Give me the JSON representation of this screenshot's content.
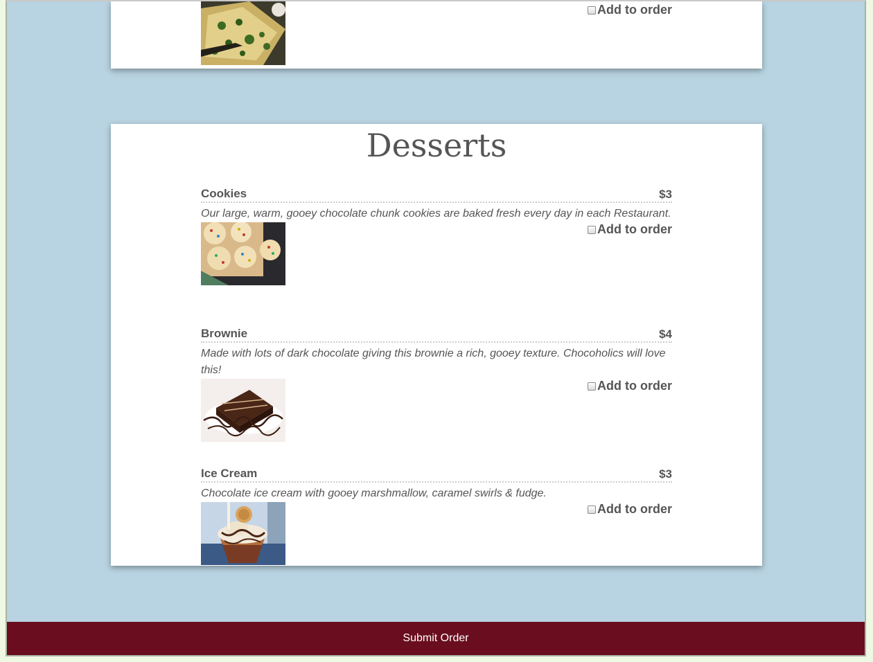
{
  "top_partial": {
    "add_label": "Add to order"
  },
  "desserts": {
    "title": "Desserts",
    "items": [
      {
        "name": "Cookies",
        "price": "$3",
        "description": "Our large, warm, gooey chocolate chunk cookies are baked fresh every day in each Restaurant.",
        "add_label": "Add to order",
        "image_icon": "cookies-photo"
      },
      {
        "name": "Brownie",
        "price": "$4",
        "description": "Made with lots of dark chocolate giving this brownie a rich, gooey texture. Chocoholics will love this!",
        "add_label": "Add to order",
        "image_icon": "brownie-photo"
      },
      {
        "name": "Ice Cream",
        "price": "$3",
        "description": "Chocolate ice cream with gooey marshmallow, caramel swirls & fudge.",
        "add_label": "Add to order",
        "image_icon": "ice-cream-photo"
      }
    ]
  },
  "footer": {
    "submit_label": "Submit Order"
  },
  "colors": {
    "page_bg": "#b8d3e1",
    "card_bg": "#ffffff",
    "submit_bg": "#6a0d1e",
    "text": "#555555"
  }
}
